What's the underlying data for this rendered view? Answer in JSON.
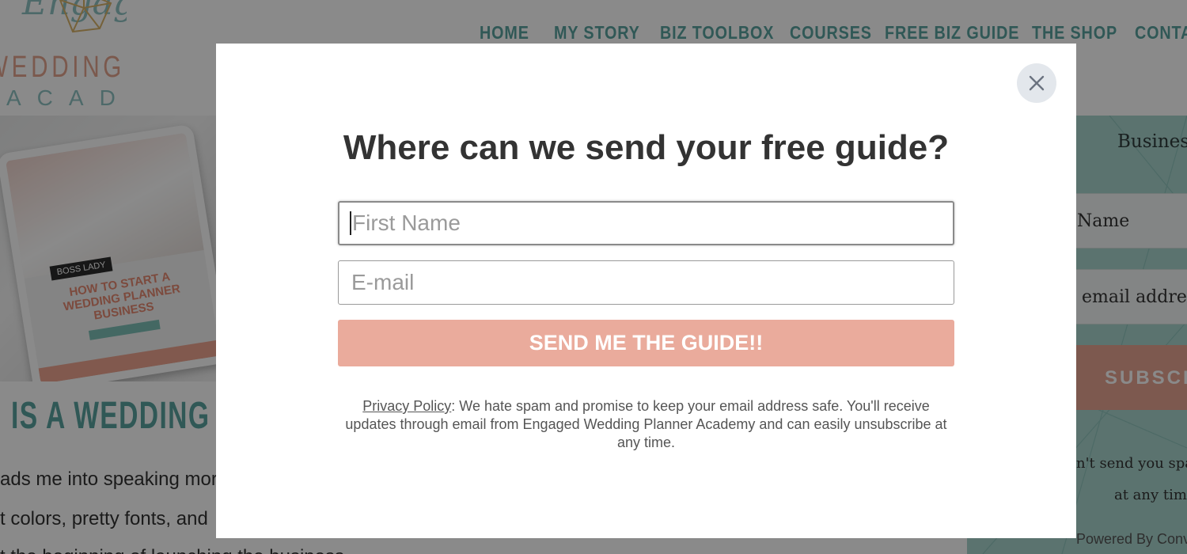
{
  "site": {
    "logo": {
      "script": "Engaged",
      "line1": "WEDDING PLANNER",
      "line2": "ACADEMY"
    },
    "nav": [
      {
        "label": "HOME"
      },
      {
        "label": "MY STORY"
      },
      {
        "label": "BIZ TOOLBOX"
      },
      {
        "label": "COURSES"
      },
      {
        "label": "FREE BIZ GUIDE"
      },
      {
        "label": "THE SHOP"
      },
      {
        "label": "CONTACT"
      }
    ],
    "hero": {
      "tablet_label": "BOSS LADY",
      "tablet_title": "HOW TO START A WEDDING PLANNER BUSINESS"
    },
    "page_heading": "IS A WEDDING PLANNER",
    "body_lines": [
      "ads me into speaking more",
      "t colors, pretty fonts, and",
      "t the beginning of launching the business"
    ],
    "sidebar": {
      "title": "Business",
      "name_placeholder": "Name",
      "email_placeholder": "email address",
      "subscribe_label": "SUBSCRIBE",
      "note_line1": "n't send you spam",
      "note_line2": "at any time",
      "powered": "Powered By Convert"
    }
  },
  "modal": {
    "title": "Where can we send your free guide?",
    "first_name_placeholder": "First Name",
    "email_placeholder": "E-mail",
    "submit_label": "SEND ME THE GUIDE!!",
    "privacy_link": "Privacy Policy",
    "privacy_text": ": We hate spam and promise to keep your email address safe. You'll receive updates through email from Engaged Wedding Planner Academy and can easily unsubscribe at any time."
  },
  "colors": {
    "accent_teal": "#5aa3a0",
    "accent_coral": "#eaab9c",
    "overlay": "rgba(0,0,0,0.46)"
  }
}
